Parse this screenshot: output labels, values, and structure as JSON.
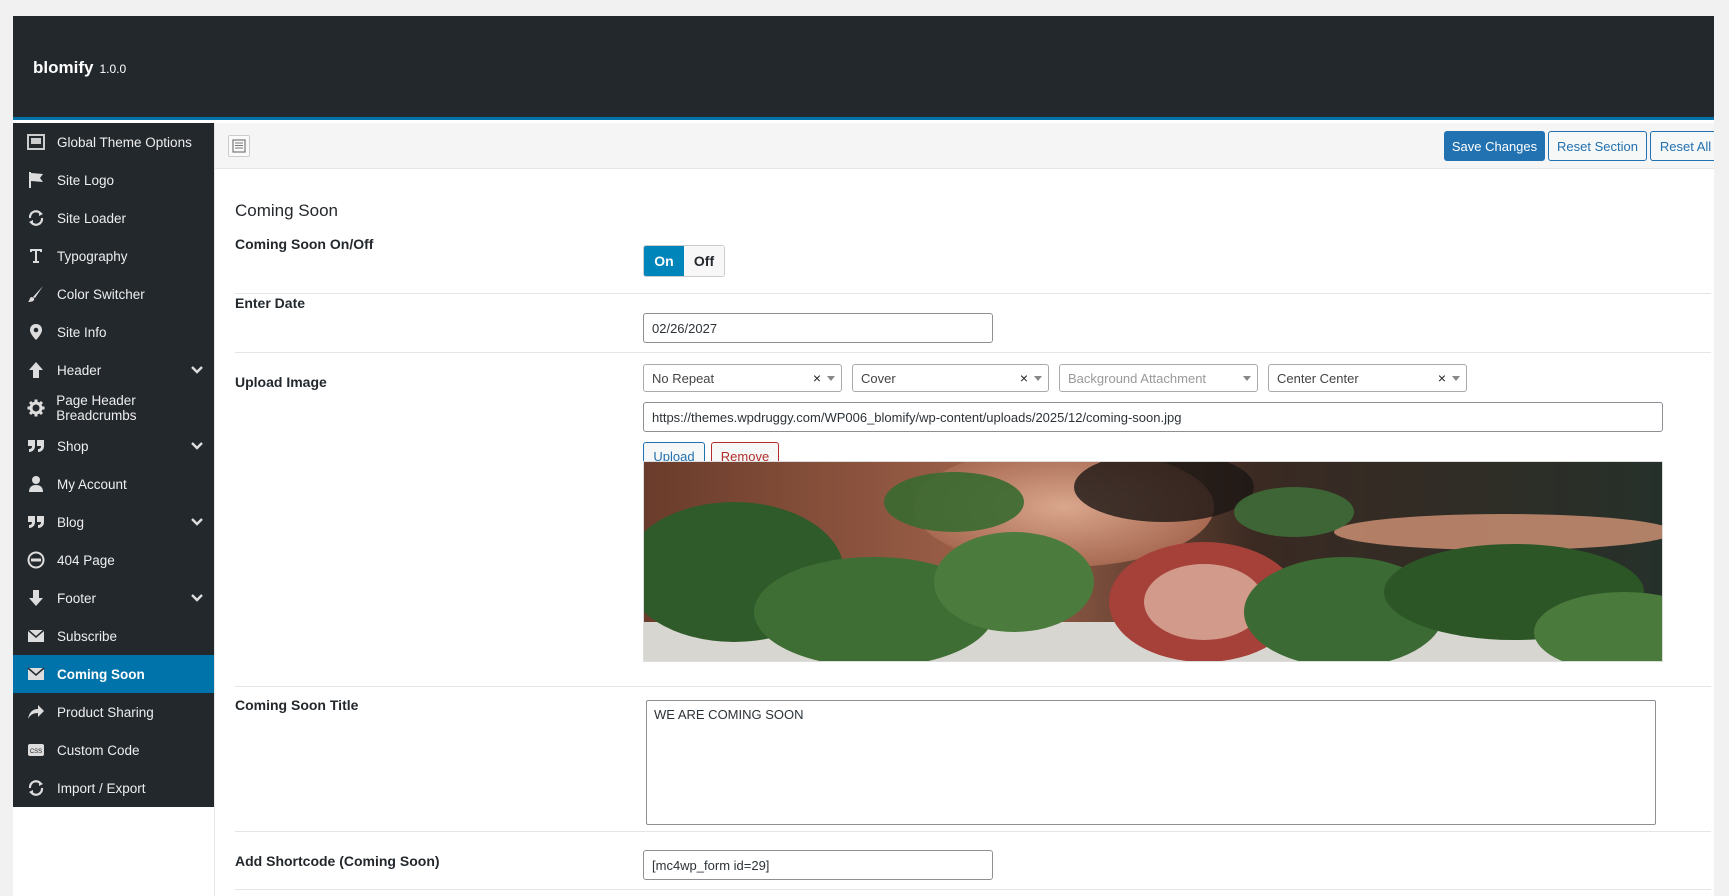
{
  "app": {
    "name": "blomify",
    "version": "1.0.0"
  },
  "sidebar": {
    "items": [
      {
        "label": "Global Theme Options",
        "icon": "layout-icon",
        "expandable": false,
        "active": false
      },
      {
        "label": "Site Logo",
        "icon": "flag-icon",
        "expandable": false,
        "active": false
      },
      {
        "label": "Site Loader",
        "icon": "refresh-icon",
        "expandable": false,
        "active": false
      },
      {
        "label": "Typography",
        "icon": "text-icon",
        "expandable": false,
        "active": false
      },
      {
        "label": "Color Switcher",
        "icon": "brush-icon",
        "expandable": false,
        "active": false
      },
      {
        "label": "Site Info",
        "icon": "location-pin-icon",
        "expandable": false,
        "active": false
      },
      {
        "label": "Header",
        "icon": "arrow-up-icon",
        "expandable": true,
        "active": false
      },
      {
        "label": "Page Header Breadcrumbs",
        "icon": "gear-icon",
        "expandable": false,
        "active": false
      },
      {
        "label": "Shop",
        "icon": "quote-icon",
        "expandable": true,
        "active": false
      },
      {
        "label": "My Account",
        "icon": "user-icon",
        "expandable": false,
        "active": false
      },
      {
        "label": "Blog",
        "icon": "quote-icon",
        "expandable": true,
        "active": false
      },
      {
        "label": "404 Page",
        "icon": "minus-circle-icon",
        "expandable": false,
        "active": false
      },
      {
        "label": "Footer",
        "icon": "arrow-down-icon",
        "expandable": true,
        "active": false
      },
      {
        "label": "Subscribe",
        "icon": "envelope-icon",
        "expandable": false,
        "active": false
      },
      {
        "label": "Coming Soon",
        "icon": "envelope-icon",
        "expandable": false,
        "active": true
      },
      {
        "label": "Product Sharing",
        "icon": "share-icon",
        "expandable": false,
        "active": false
      },
      {
        "label": "Custom Code",
        "icon": "css-icon",
        "expandable": false,
        "active": false
      },
      {
        "label": "Import / Export",
        "icon": "refresh-icon",
        "expandable": false,
        "active": false
      }
    ]
  },
  "toolbar": {
    "save_label": "Save Changes",
    "reset_section_label": "Reset Section",
    "reset_all_label": "Reset All"
  },
  "section": {
    "title": "Coming Soon",
    "toggle": {
      "label": "Coming Soon On/Off",
      "on_label": "On",
      "off_label": "Off",
      "value": "On"
    },
    "date": {
      "label": "Enter Date",
      "value": "02/26/2027"
    },
    "upload": {
      "label": "Upload Image",
      "repeat": "No Repeat",
      "size": "Cover",
      "attachment_placeholder": "Background Attachment",
      "position": "Center Center",
      "url": "https://themes.wpdruggy.com/WP006_blomify/wp-content/uploads/2025/12/coming-soon.jpg",
      "upload_label": "Upload",
      "remove_label": "Remove"
    },
    "title_field": {
      "label": "Coming Soon Title",
      "value": "WE ARE COMING SOON"
    },
    "shortcode": {
      "label": "Add Shortcode (Coming Soon)",
      "value": "[mc4wp_form id=29]"
    }
  },
  "colors": {
    "topbar_bg": "#23282d",
    "accent": "#0073aa",
    "primary_button": "#2271b1",
    "remove_text": "#b32d2e"
  }
}
